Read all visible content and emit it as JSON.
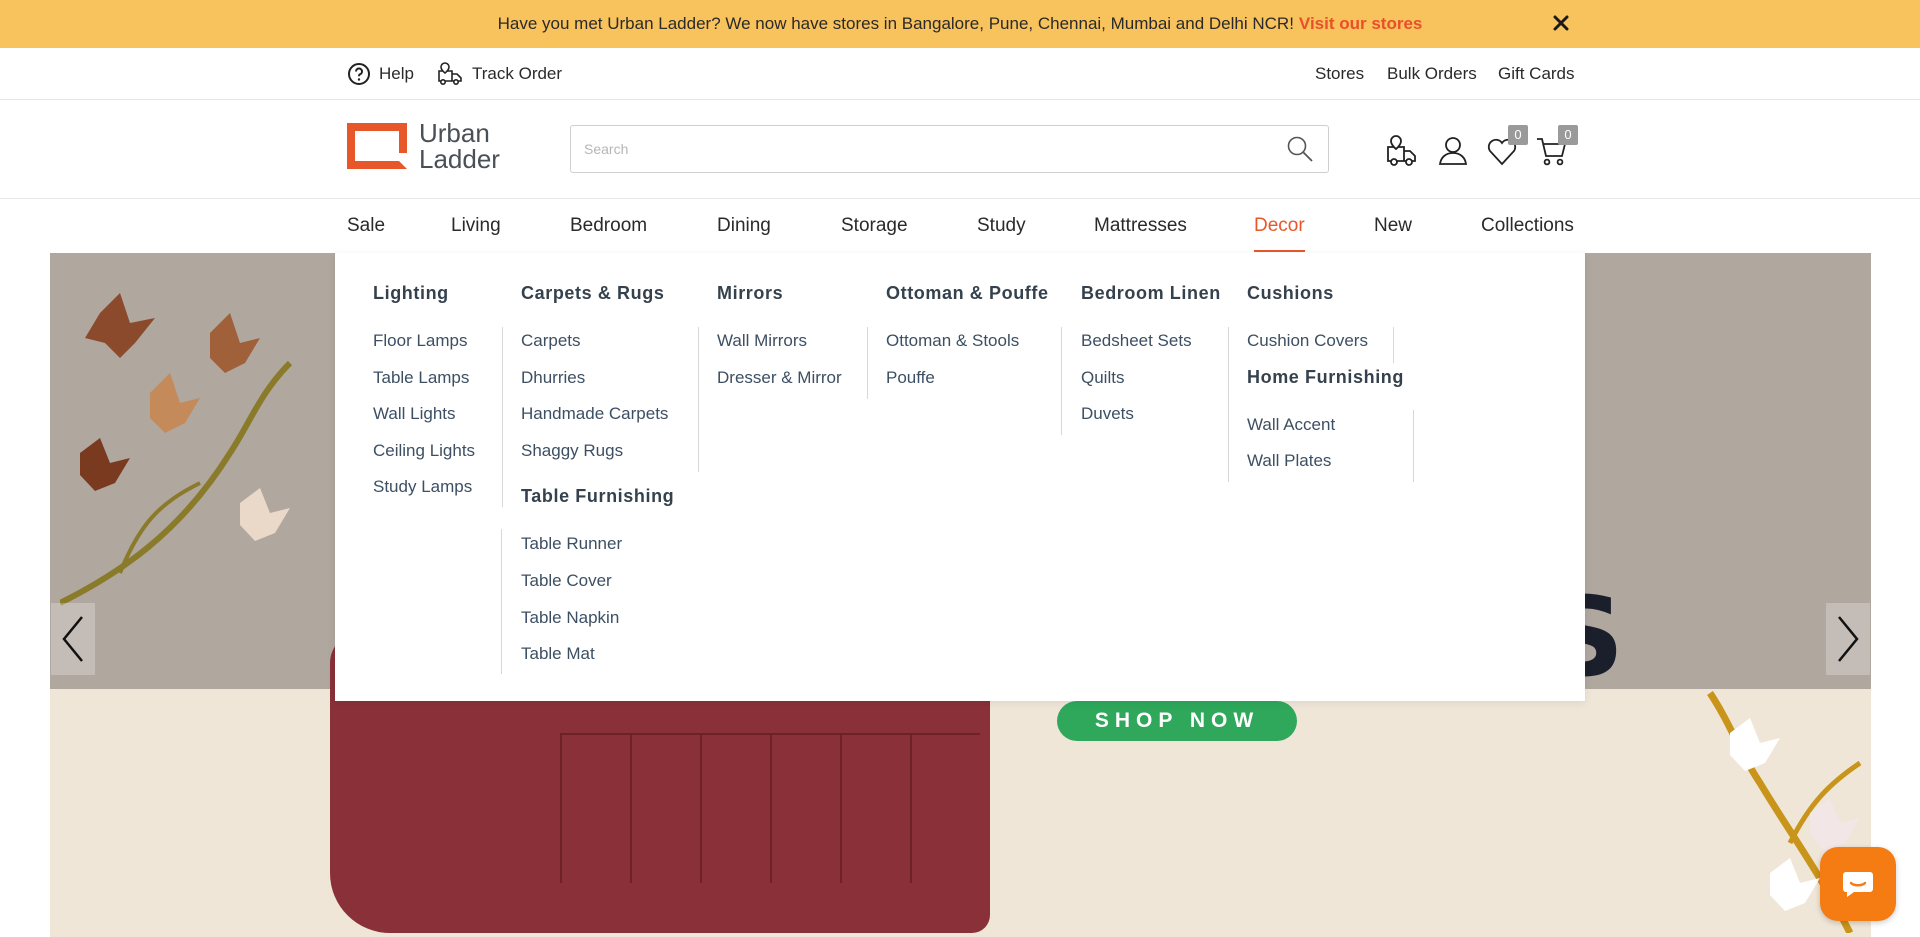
{
  "announcement": {
    "text": "Have you met Urban Ladder? We now have stores in Bangalore, Pune, Chennai, Mumbai and Delhi NCR!",
    "link": "Visit our stores",
    "close_icon": "close-icon"
  },
  "utility": {
    "help": "Help",
    "track_order": "Track Order",
    "stores": "Stores",
    "bulk_orders": "Bulk Orders",
    "gift_cards": "Gift Cards"
  },
  "header": {
    "logo_line1": "Urban",
    "logo_line2": "Ladder",
    "search_placeholder": "Search",
    "wishlist_count": "0",
    "cart_count": "0"
  },
  "nav": {
    "items": [
      "Sale",
      "Living",
      "Bedroom",
      "Dining",
      "Storage",
      "Study",
      "Mattresses",
      "Decor",
      "New",
      "Collections"
    ],
    "active": "Decor"
  },
  "mega_menu": {
    "lighting": {
      "title": "Lighting",
      "links": [
        "Floor Lamps",
        "Table Lamps",
        "Wall Lights",
        "Ceiling Lights",
        "Study Lamps"
      ]
    },
    "carpets": {
      "title": "Carpets & Rugs",
      "links": [
        "Carpets",
        "Dhurries",
        "Handmade Carpets",
        "Shaggy Rugs"
      ]
    },
    "table_furnishing": {
      "title": "Table Furnishing",
      "links": [
        "Table Runner",
        "Table Cover",
        "Table Napkin",
        "Table Mat"
      ]
    },
    "mirrors": {
      "title": "Mirrors",
      "links": [
        "Wall Mirrors",
        "Dresser & Mirror"
      ]
    },
    "ottoman": {
      "title": "Ottoman & Pouffe",
      "links": [
        "Ottoman & Stools",
        "Pouffe"
      ]
    },
    "bedroom_linen": {
      "title": "Bedroom Linen",
      "links": [
        "Bedsheet Sets",
        "Quilts",
        "Duvets"
      ]
    },
    "cushions": {
      "title": "Cushions",
      "links": [
        "Cushion Covers"
      ]
    },
    "home_furnishing": {
      "title": "Home Furnishing",
      "links": [
        "Wall Accent",
        "Wall Plates"
      ]
    }
  },
  "hero": {
    "shop_now": "SHOP NOW",
    "partial_letter": "S"
  },
  "colors": {
    "announcement_bg": "#f8c25c",
    "accent": "#e8572a",
    "link_red": "#e8502b",
    "shop_now_green": "#2fa85b",
    "chat_orange": "#f57c12"
  }
}
